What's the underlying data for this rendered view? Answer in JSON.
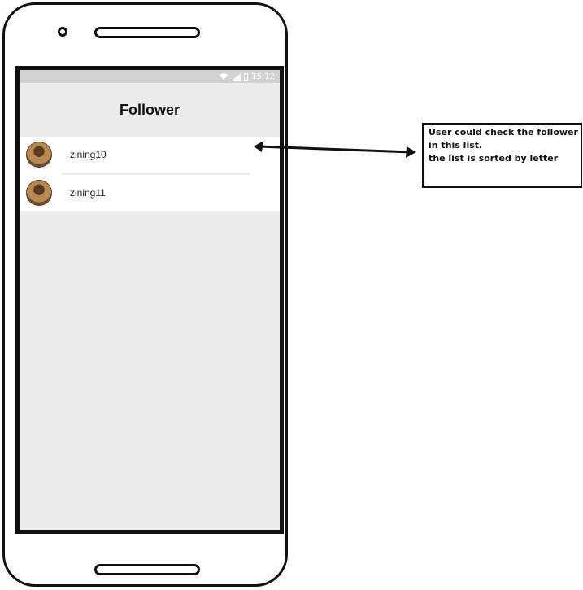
{
  "status_bar": {
    "time": "15:12",
    "icons": [
      "wifi-icon",
      "signal-icon",
      "battery-icon"
    ]
  },
  "screen": {
    "title": "Follower",
    "followers": [
      {
        "name": "zining10",
        "avatar": "avatar-photo"
      },
      {
        "name": "zining11",
        "avatar": "avatar-photo"
      }
    ]
  },
  "annotation": {
    "lines": [
      "User could check the follower",
      "in this list.",
      "the list is sorted by letter"
    ]
  },
  "colors": {
    "screen_background": "#ececec",
    "status_bar": "#d2d2d2",
    "list_background": "#ffffff",
    "outline": "#111111"
  }
}
